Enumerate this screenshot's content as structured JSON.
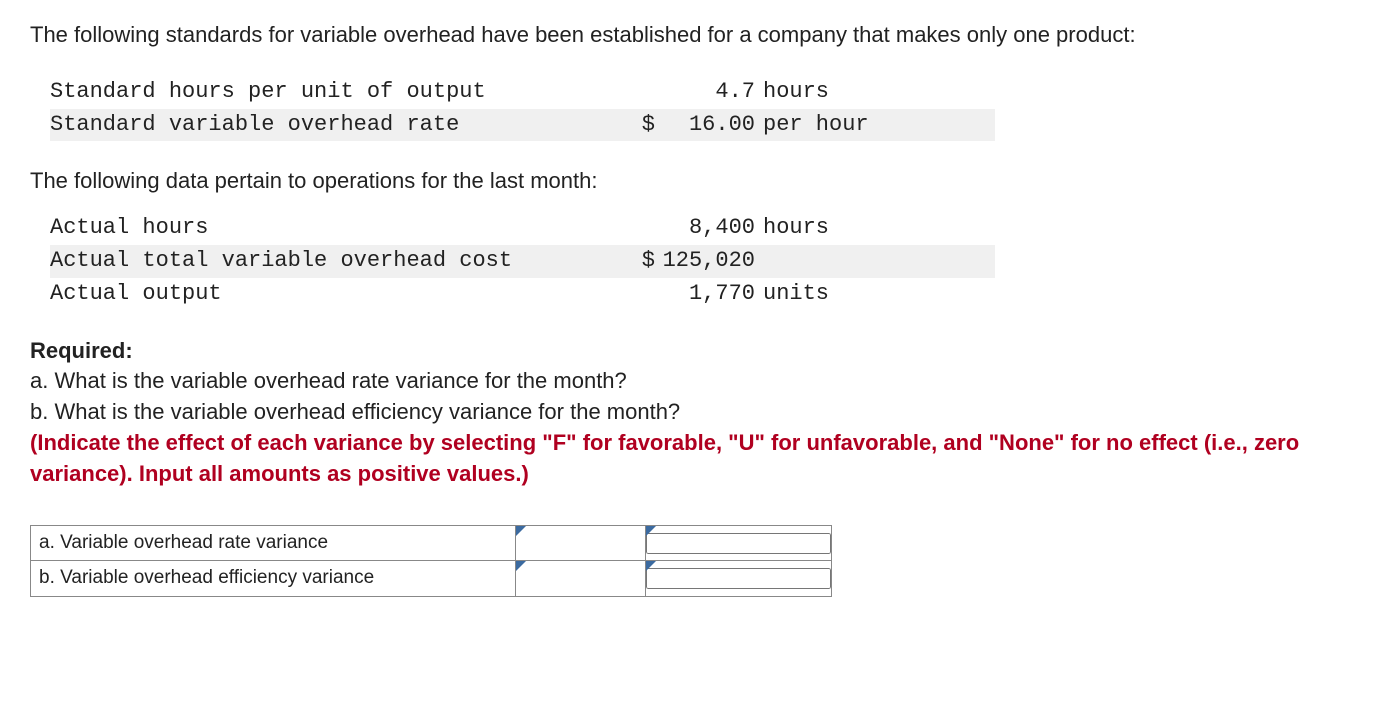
{
  "intro": "The following standards for variable overhead have been established for a company that makes only one product:",
  "standards": [
    {
      "label": "Standard hours per unit of output",
      "sym": "",
      "value": "4.7",
      "unit": "hours",
      "shaded": false
    },
    {
      "label": "Standard variable overhead rate",
      "sym": "$",
      "value": "16.00",
      "unit": "per hour",
      "shaded": true
    }
  ],
  "mid": "The following data pertain to operations for the last month:",
  "actuals": [
    {
      "label": "Actual hours",
      "sym": "",
      "value": "8,400",
      "unit": "hours",
      "shaded": false
    },
    {
      "label": "Actual total variable overhead cost",
      "sym": "$",
      "value": "125,020",
      "unit": "",
      "shaded": true
    },
    {
      "label": "Actual output",
      "sym": "",
      "value": "1,770",
      "unit": "units",
      "shaded": false
    }
  ],
  "required": {
    "heading": "Required:",
    "a": "a. What is the variable overhead rate variance for the month?",
    "b": "b. What is the variable overhead efficiency variance for the month?",
    "instruction": "(Indicate the effect of each variance by selecting \"F\" for favorable, \"U\" for unfavorable, and \"None\" for no effect (i.e., zero variance). Input all amounts as positive values.)"
  },
  "answers": {
    "a_label": "a. Variable overhead rate variance",
    "b_label": "b. Variable overhead efficiency variance"
  }
}
